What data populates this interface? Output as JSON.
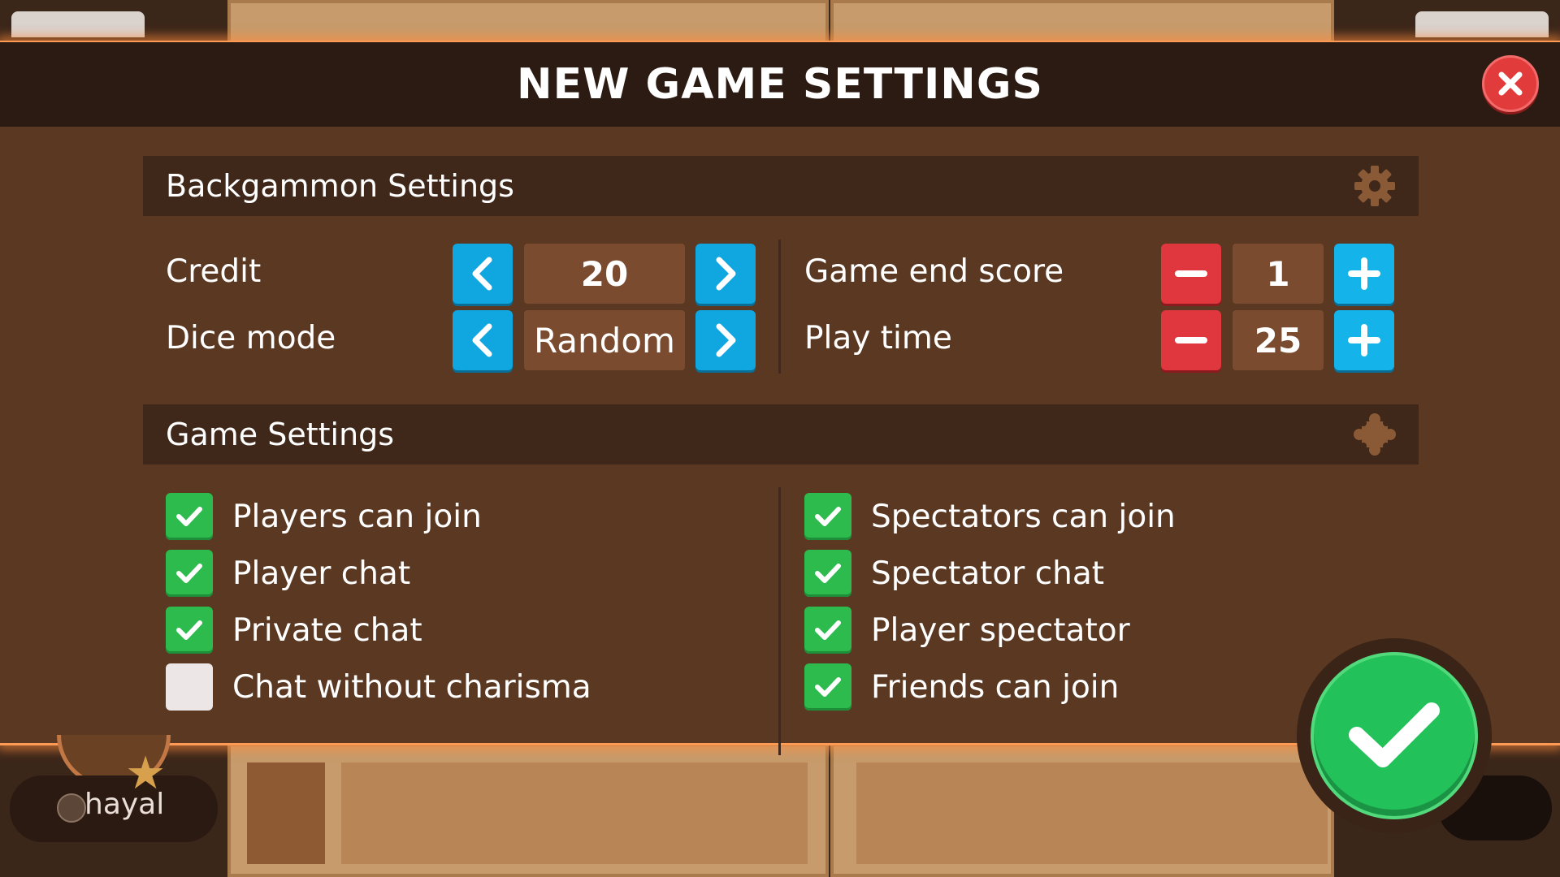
{
  "dialog": {
    "title": "NEW GAME SETTINGS"
  },
  "backgammon_section": {
    "title": "Backgammon Settings",
    "icon": "gear-icon",
    "credit": {
      "label": "Credit",
      "value": "20"
    },
    "dice_mode": {
      "label": "Dice mode",
      "value": "Random"
    },
    "game_end_score": {
      "label": "Game end score",
      "value": "1"
    },
    "play_time": {
      "label": "Play time",
      "value": "25"
    }
  },
  "game_section": {
    "title": "Game Settings",
    "icon": "puzzle-icon",
    "left_options": [
      {
        "label": "Players can join",
        "checked": true
      },
      {
        "label": "Player chat",
        "checked": true
      },
      {
        "label": "Private chat",
        "checked": true
      },
      {
        "label": "Chat without charisma",
        "checked": false
      }
    ],
    "right_options": [
      {
        "label": "Spectators can join",
        "checked": true
      },
      {
        "label": "Spectator chat",
        "checked": true
      },
      {
        "label": "Player spectator",
        "checked": true
      },
      {
        "label": "Friends can join",
        "checked": true
      }
    ]
  },
  "player": {
    "name": "hayal"
  },
  "colors": {
    "accent_blue": "#10a6e0",
    "accent_red": "#e0363d",
    "accent_green": "#23c15a",
    "panel_brown": "#5a3822",
    "header_dark": "#2c1b12"
  }
}
